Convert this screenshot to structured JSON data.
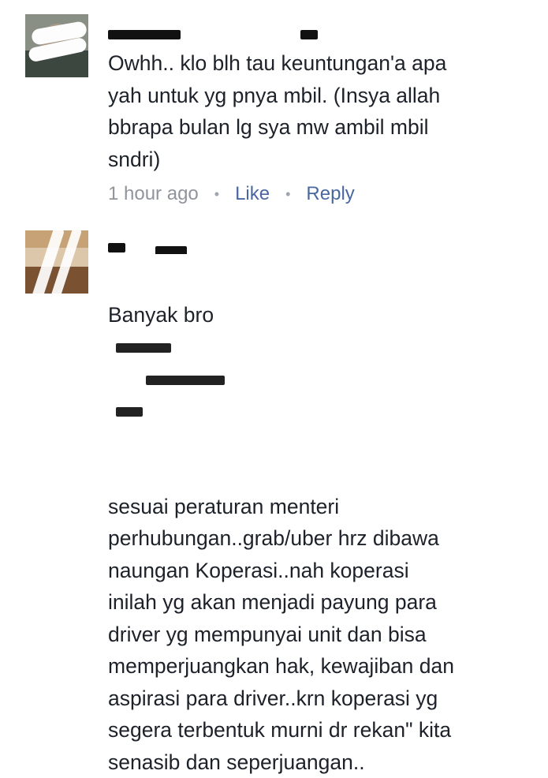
{
  "comments": [
    {
      "body": "Owhh.. klo blh tau keuntungan'a apa\nyah untuk yg pnya mbil. (Insya allah\nbbrapa bulan lg sya mw ambil mbil\nsndri)",
      "time": "1 hour ago",
      "like_label": "Like",
      "reply_label": "Reply"
    },
    {
      "body_prefix": "Banyak bro",
      "body": "sesuai peraturan menteri\nperhubungan..grab/uber hrz dibawa\nnaungan Koperasi..nah koperasi\ninilah yg akan menjadi payung para\ndriver yg mempunyai unit dan bisa\nmemperjuangkan hak, kewajiban dan\naspirasi para driver..krn koperasi yg\nsegera terbentuk murni dr rekan\" kita\nsenasib dan seperjuangan.."
    }
  ],
  "colors": {
    "text": "#1d2129",
    "meta": "#90949c",
    "link": "#4b67a1"
  }
}
